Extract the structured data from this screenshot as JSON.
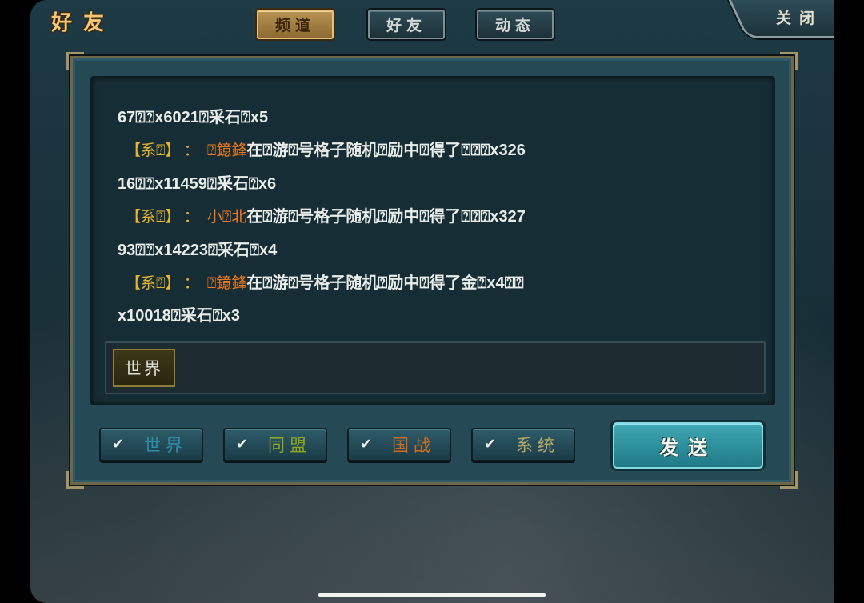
{
  "header": {
    "title": "好友"
  },
  "tabs": [
    {
      "label": "频道",
      "active": true
    },
    {
      "label": "好友",
      "active": false
    },
    {
      "label": "动态",
      "active": false
    }
  ],
  "close_label": "关闭",
  "chat_lines": [
    {
      "type": "cont",
      "text": "67⍰⍰x6021⍰采石⍰x5"
    },
    {
      "type": "sys",
      "tag": "【系⍰】",
      "colon": "：",
      "name": "⍰鐿鋒",
      "text": "在⍰游⍰号格子随机⍰励中⍰得了⍰⍰⍰x326"
    },
    {
      "type": "cont",
      "text": "16⍰⍰x11459⍰采石⍰x6"
    },
    {
      "type": "sys",
      "tag": "【系⍰】",
      "colon": "：",
      "name": "小⍰北",
      "text": "在⍰游⍰号格子随机⍰励中⍰得了⍰⍰⍰x327"
    },
    {
      "type": "cont",
      "text": "93⍰⍰x14223⍰采石⍰x4"
    },
    {
      "type": "sys",
      "tag": "【系⍰】",
      "colon": "：",
      "name": "⍰鐿鋒",
      "text": "在⍰游⍰号格子随机⍰励中⍰得了金⍰x4⍰⍰"
    },
    {
      "type": "cont",
      "text": "x10018⍰采石⍰x3"
    }
  ],
  "input": {
    "channel": "世界",
    "value": ""
  },
  "filters": [
    {
      "label": "世界",
      "checked": true,
      "color": "#2f8fa8"
    },
    {
      "label": "同盟",
      "checked": true,
      "color": "#8fa81e"
    },
    {
      "label": "国战",
      "checked": true,
      "color": "#d26b1a"
    },
    {
      "label": "系统",
      "checked": true,
      "color": "#b7a866"
    }
  ],
  "checkmark": "✔",
  "send_label": "发送",
  "colors": {
    "system_tag": "#e8b530",
    "player_name": "#f07a1a",
    "accent_gold": "#f1c878"
  }
}
